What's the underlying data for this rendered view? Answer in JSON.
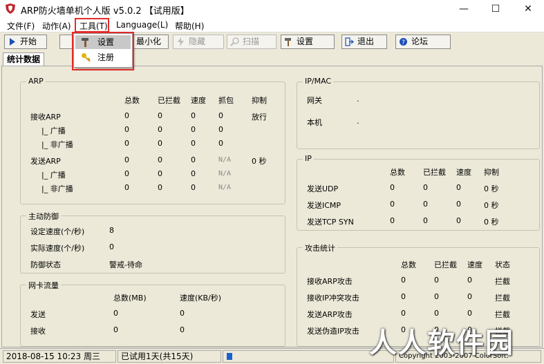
{
  "window": {
    "title": "ARP防火墙单机个人版 v5.0.2 【试用版】",
    "controls": {
      "minimize": "—",
      "maximize": "☐",
      "close": "✕"
    }
  },
  "menubar": {
    "items": [
      "文件(F)",
      "动作(A)",
      "工具(T)",
      "Language(L)",
      "帮助(H)"
    ]
  },
  "tools_menu": {
    "items": [
      "设置",
      "注册"
    ]
  },
  "toolbar": {
    "buttons": [
      "开始",
      "最小化",
      "隐藏",
      "扫描",
      "设置",
      "退出",
      "论坛"
    ]
  },
  "tab": {
    "label": "统计数据"
  },
  "arp": {
    "title": "ARP",
    "headers": [
      "总数",
      "已拦截",
      "速度",
      "抓包",
      "抑制"
    ],
    "rows": [
      {
        "label": "接收ARP",
        "vals": [
          "0",
          "0",
          "0",
          "0"
        ],
        "extra": "放行"
      },
      {
        "label": "|_ 广播",
        "vals": [
          "0",
          "0",
          "0",
          "0"
        ],
        "extra": ""
      },
      {
        "label": "|_ 非广播",
        "vals": [
          "0",
          "0",
          "0",
          "0"
        ],
        "extra": ""
      },
      {
        "label": "发送ARP",
        "vals": [
          "0",
          "0",
          "0",
          "N/A"
        ],
        "extra": "0 秒"
      },
      {
        "label": "|_ 广播",
        "vals": [
          "0",
          "0",
          "0",
          "N/A"
        ],
        "extra": ""
      },
      {
        "label": "|_ 非广播",
        "vals": [
          "0",
          "0",
          "0",
          "N/A"
        ],
        "extra": ""
      }
    ]
  },
  "active_defense": {
    "title": "主动防御",
    "rows": [
      {
        "label": "设定速度(个/秒)",
        "value": "8"
      },
      {
        "label": "实际速度(个/秒)",
        "value": "0"
      },
      {
        "label": "防御状态",
        "value": "警戒-待命"
      }
    ]
  },
  "nic_traffic": {
    "title": "网卡流量",
    "headers": [
      "总数(MB)",
      "速度(KB/秒)"
    ],
    "rows": [
      {
        "label": "发送",
        "vals": [
          "0",
          "0"
        ]
      },
      {
        "label": "接收",
        "vals": [
          "0",
          "0"
        ]
      }
    ]
  },
  "ipmac": {
    "title": "IP/MAC",
    "rows": [
      {
        "label": "网关",
        "value": "."
      },
      {
        "label": "本机",
        "value": "."
      }
    ]
  },
  "ip": {
    "title": "IP",
    "headers": [
      "总数",
      "已拦截",
      "速度",
      "抑制"
    ],
    "rows": [
      {
        "label": "发送UDP",
        "vals": [
          "0",
          "0",
          "0",
          "0 秒"
        ]
      },
      {
        "label": "发送ICMP",
        "vals": [
          "0",
          "0",
          "0",
          "0 秒"
        ]
      },
      {
        "label": "发送TCP SYN",
        "vals": [
          "0",
          "0",
          "0",
          "0 秒"
        ]
      }
    ]
  },
  "attack": {
    "title": "攻击统计",
    "headers": [
      "总数",
      "已拦截",
      "速度",
      "状态"
    ],
    "rows": [
      {
        "label": "接收ARP攻击",
        "vals": [
          "0",
          "0",
          "0",
          "拦截"
        ]
      },
      {
        "label": "接收IP冲突攻击",
        "vals": [
          "0",
          "0",
          "0",
          "拦截"
        ]
      },
      {
        "label": "发送ARP攻击",
        "vals": [
          "0",
          "0",
          "0",
          "拦截"
        ]
      },
      {
        "label": "发送伪造IP攻击",
        "vals": [
          "0",
          "0",
          "0",
          "拦截"
        ]
      }
    ]
  },
  "statusbar": {
    "datetime": "2018-08-15 10:23 周三",
    "trial": "已试用1天(共15天)",
    "copyright": "Copyright 2003-2007 ColorSoft."
  },
  "watermark": "人人软件园",
  "colors": {
    "highlight_box": "#e32b2b",
    "progress": "#1a5fd1"
  }
}
